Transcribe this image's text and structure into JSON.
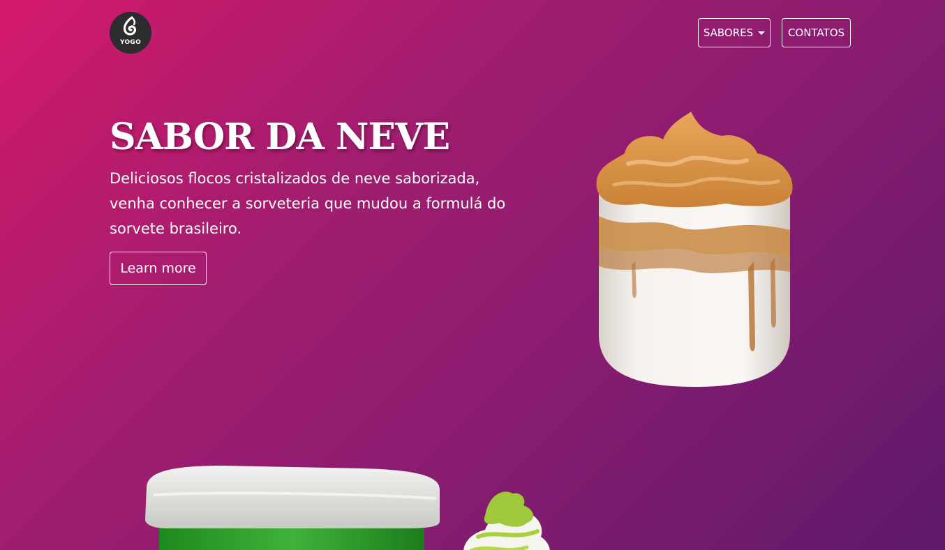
{
  "header": {
    "logo_text": "YOGO",
    "nav": {
      "sabores_label": "SABORES",
      "contatos_label": "CONTATOS"
    }
  },
  "hero": {
    "title": "SABOR DA NEVE",
    "description": "Deliciosos flocos cristalizados de neve saborizada, venha conhecer a sorveteria que mudou a formulá do sorvete brasileiro.",
    "cta_label": "Learn more"
  },
  "images": {
    "hero_image": "dalgona-coffee-glass",
    "bottom_left_image": "green-ice-cream-tub",
    "bottom_middle_image": "pistachio-whipped-dessert"
  },
  "colors": {
    "gradient_start": "#d4196b",
    "gradient_end": "#5e1a6b",
    "logo_bg": "#2c2b2e",
    "text": "#ffffff"
  },
  "icons": [
    "yogo-logo-icon",
    "dropdown-caret-icon"
  ]
}
